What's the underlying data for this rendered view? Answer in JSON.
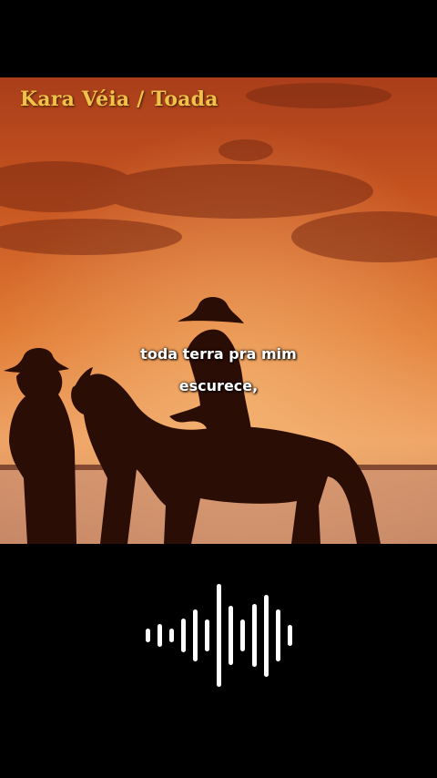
{
  "video": {
    "title": "Kara Véia / Toada",
    "lyrics": [
      "toda terra pra mim",
      "escurece,"
    ]
  },
  "artwork": {
    "icon": "sunset-cowboys-silhouette-image",
    "colors": {
      "sky_top": "#b8461c",
      "sky_mid": "#dc6a24",
      "sky_horizon": "#f0a05a",
      "silhouette": "#2a0d05"
    }
  },
  "audio_visualizer": {
    "icon": "sound-wave-icon",
    "color": "#ffffff",
    "levels": [
      0.12,
      0.2,
      0.12,
      0.3,
      0.45,
      0.28,
      0.9,
      0.52,
      0.28,
      0.55,
      0.72,
      0.45,
      0.18
    ]
  }
}
